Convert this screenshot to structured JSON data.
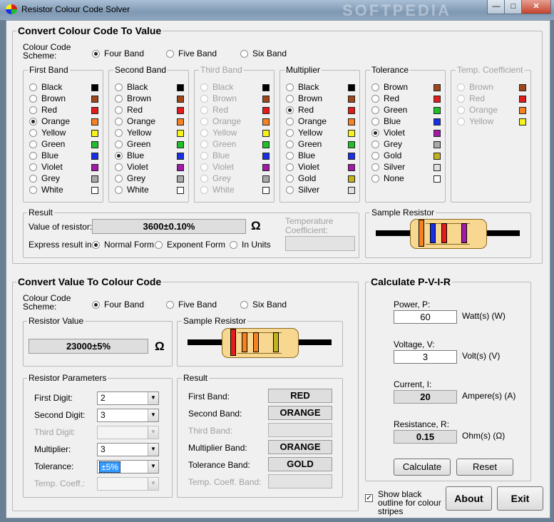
{
  "window": {
    "title": "Resistor Colour Code Solver",
    "watermark": "SOFTPEDIA",
    "minimize_glyph": "—",
    "maximize_glyph": "□",
    "close_glyph": "✕",
    "app_icon": "resistor-app-icon"
  },
  "section1": {
    "title": "Convert Colour Code To Value",
    "scheme_label": "Colour Code Scheme:",
    "scheme_options": [
      "Four Band",
      "Five Band",
      "Six Band"
    ],
    "bands": [
      {
        "title": "First Band",
        "enabled": true,
        "selected": 3,
        "items": [
          [
            "Black",
            "#000000"
          ],
          [
            "Brown",
            "#a0471a"
          ],
          [
            "Red",
            "#e21c1c"
          ],
          [
            "Orange",
            "#f58220"
          ],
          [
            "Yellow",
            "#f5f21c"
          ],
          [
            "Green",
            "#1fbf2a"
          ],
          [
            "Blue",
            "#1730e6"
          ],
          [
            "Violet",
            "#a11aa8"
          ],
          [
            "Grey",
            "#a8a8a8"
          ],
          [
            "White",
            "#ffffff"
          ]
        ]
      },
      {
        "title": "Second Band",
        "enabled": true,
        "selected": 6,
        "items": [
          [
            "Black",
            "#000000"
          ],
          [
            "Brown",
            "#a0471a"
          ],
          [
            "Red",
            "#e21c1c"
          ],
          [
            "Orange",
            "#f58220"
          ],
          [
            "Yellow",
            "#f5f21c"
          ],
          [
            "Green",
            "#1fbf2a"
          ],
          [
            "Blue",
            "#1730e6"
          ],
          [
            "Violet",
            "#a11aa8"
          ],
          [
            "Grey",
            "#a8a8a8"
          ],
          [
            "White",
            "#ffffff"
          ]
        ]
      },
      {
        "title": "Third Band",
        "enabled": false,
        "selected": -1,
        "items": [
          [
            "Black",
            "#000000"
          ],
          [
            "Brown",
            "#a0471a"
          ],
          [
            "Red",
            "#e21c1c"
          ],
          [
            "Orange",
            "#f58220"
          ],
          [
            "Yellow",
            "#f5f21c"
          ],
          [
            "Green",
            "#1fbf2a"
          ],
          [
            "Blue",
            "#1730e6"
          ],
          [
            "Violet",
            "#a11aa8"
          ],
          [
            "Grey",
            "#a8a8a8"
          ],
          [
            "White",
            "#ffffff"
          ]
        ]
      },
      {
        "title": "Multiplier",
        "enabled": true,
        "selected": 2,
        "items": [
          [
            "Black",
            "#000000"
          ],
          [
            "Brown",
            "#a0471a"
          ],
          [
            "Red",
            "#e21c1c"
          ],
          [
            "Orange",
            "#f58220"
          ],
          [
            "Yellow",
            "#f5f21c"
          ],
          [
            "Green",
            "#1fbf2a"
          ],
          [
            "Blue",
            "#1730e6"
          ],
          [
            "Violet",
            "#a11aa8"
          ],
          [
            "Gold",
            "#c2b21b"
          ],
          [
            "Silver",
            "#e0e0e0"
          ]
        ]
      },
      {
        "title": "Tolerance",
        "enabled": true,
        "selected": 4,
        "items": [
          [
            "Brown",
            "#a0471a"
          ],
          [
            "Red",
            "#e21c1c"
          ],
          [
            "Green",
            "#1fbf2a"
          ],
          [
            "Blue",
            "#1730e6"
          ],
          [
            "Violet",
            "#a11aa8"
          ],
          [
            "Grey",
            "#a8a8a8"
          ],
          [
            "Gold",
            "#c2b21b"
          ],
          [
            "Silver",
            "#e0e0e0"
          ],
          [
            "None",
            "#ffffff"
          ]
        ]
      },
      {
        "title": "Temp. Coefficient",
        "enabled": false,
        "selected": -1,
        "items": [
          [
            "Brown",
            "#a0471a"
          ],
          [
            "Red",
            "#e21c1c"
          ],
          [
            "Orange",
            "#f58220"
          ],
          [
            "Yellow",
            "#f5f21c"
          ]
        ]
      }
    ],
    "result": {
      "title": "Result",
      "value_label": "Value of resistor:",
      "value": "3600±0.10%",
      "ohm": "Ω",
      "express_label": "Express result in:",
      "express_options": [
        "Normal Form",
        "Exponent Form",
        "In Units"
      ],
      "temp_label": "Temperature Coefficient:"
    },
    "sample": {
      "title": "Sample Resistor",
      "stripes": [
        "#f58220",
        "#1730e6",
        "#e21c1c",
        "#a11aa8"
      ]
    }
  },
  "section2": {
    "title": "Convert Value To Colour Code",
    "scheme_label": "Colour Code Scheme:",
    "scheme_options": [
      "Four Band",
      "Five Band",
      "Six Band"
    ],
    "resistor_value": {
      "title": "Resistor Value",
      "value": "23000±5%",
      "ohm": "Ω"
    },
    "sample": {
      "title": "Sample Resistor",
      "stripes": [
        "#e21c1c",
        "#f58220",
        "#f58220",
        "#c2b21b"
      ]
    },
    "params": {
      "title": "Resistor Parameters",
      "rows": [
        {
          "label": "First Digit:",
          "value": "2",
          "enabled": true
        },
        {
          "label": "Second Digit:",
          "value": "3",
          "enabled": true
        },
        {
          "label": "Third Digit:",
          "value": "",
          "enabled": false
        },
        {
          "label": "Multiplier:",
          "value": "3",
          "enabled": true
        },
        {
          "label": "Tolerance:",
          "value": "±5%",
          "enabled": true,
          "focused": true
        },
        {
          "label": "Temp. Coeff.:",
          "value": "",
          "enabled": false
        }
      ]
    },
    "result": {
      "title": "Result",
      "rows": [
        {
          "label": "First Band:",
          "value": "RED",
          "enabled": true
        },
        {
          "label": "Second Band:",
          "value": "ORANGE",
          "enabled": true
        },
        {
          "label": "Third Band:",
          "value": "",
          "enabled": false
        },
        {
          "label": "Multiplier Band:",
          "value": "ORANGE",
          "enabled": true
        },
        {
          "label": "Tolerance Band:",
          "value": "GOLD",
          "enabled": true
        },
        {
          "label": "Temp. Coeff. Band:",
          "value": "",
          "enabled": false
        }
      ]
    }
  },
  "pvir": {
    "title": "Calculate P-V-I-R",
    "power": {
      "label": "Power, P:",
      "value": "60",
      "unit": "Watt(s) (W)"
    },
    "voltage": {
      "label": "Voltage, V:",
      "value": "3",
      "unit": "Volt(s) (V)"
    },
    "current": {
      "label": "Current, I:",
      "value": "20",
      "unit": "Ampere(s) (A)"
    },
    "resistance": {
      "label": "Resistance, R:",
      "value": "0.15",
      "unit": "Ohm(s) (Ω)"
    },
    "calculate": "Calculate",
    "reset": "Reset"
  },
  "footer": {
    "outline_label": "Show black outline for colour stripes",
    "outline_checked": true,
    "about": "About",
    "exit": "Exit"
  }
}
